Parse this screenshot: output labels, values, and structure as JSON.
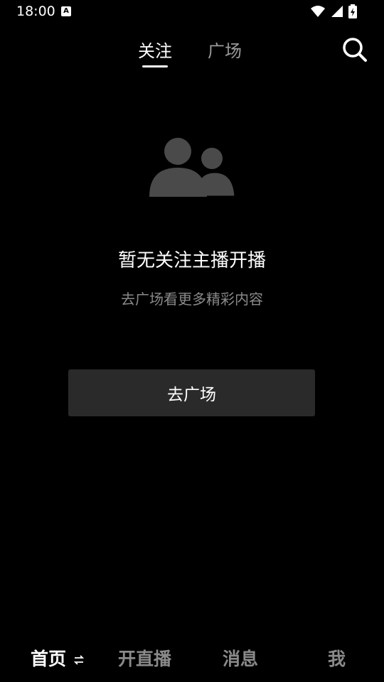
{
  "status": {
    "time": "18:00",
    "badge": "A"
  },
  "tabs": {
    "follow": "关注",
    "plaza": "广场"
  },
  "empty": {
    "title": "暂无关注主播开播",
    "subtitle": "去广场看更多精彩内容",
    "button": "去广场"
  },
  "nav": {
    "home": "首页",
    "live": "开直播",
    "messages": "消息",
    "me": "我"
  },
  "colors": {
    "background": "#000000",
    "button": "#2a2a2a",
    "muted": "#8a8a8a"
  }
}
